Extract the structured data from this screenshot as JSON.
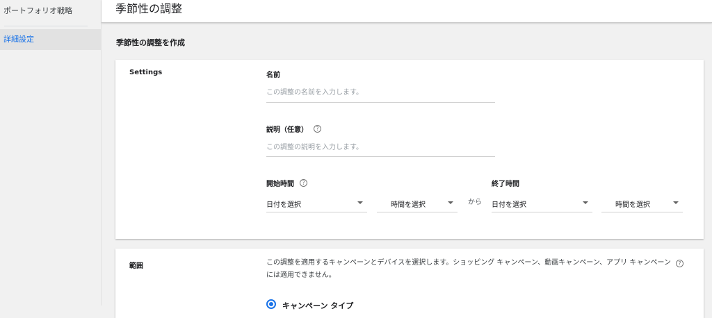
{
  "sidebar": {
    "items": [
      {
        "label": "ポートフォリオ戦略",
        "active": false
      },
      {
        "label": "詳細設定",
        "active": true
      }
    ],
    "active_color": "#1a73e8"
  },
  "header": {
    "title": "季節性の調整"
  },
  "section": {
    "title": "季節性の調整を作成"
  },
  "settings": {
    "heading": "Settings",
    "name": {
      "label": "名前",
      "placeholder": "この調整の名前を入力します。",
      "value": ""
    },
    "description": {
      "label": "説明（任意）",
      "placeholder": "この調整の説明を入力します。",
      "value": "",
      "help_icon": "help-circle-icon"
    },
    "start": {
      "label": "開始時間",
      "help_icon": "help-circle-icon",
      "date_select": "日付を選択",
      "time_select": "時間を選択"
    },
    "between": "から",
    "end": {
      "label": "終了時間",
      "date_select": "日付を選択",
      "time_select": "時間を選択"
    }
  },
  "scope": {
    "heading": "範囲",
    "description": "この調整を適用するキャンペーンとデバイスを選択します。ショッピング キャンペーン、動画キャンペーン、アプリ キャンペーンには適用できません。",
    "help_icon": "help-circle-icon",
    "radio_label": "キャンペーン タイプ",
    "radio_selected": true
  }
}
